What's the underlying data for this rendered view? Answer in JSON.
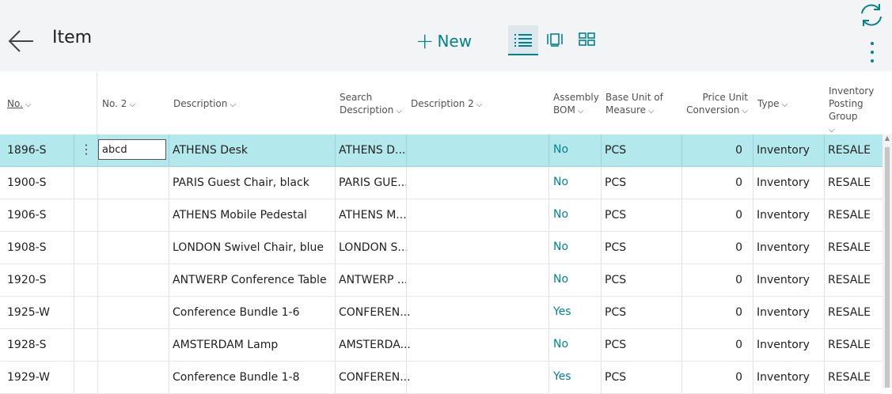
{
  "page": {
    "title": "Item",
    "new_label": "New"
  },
  "icons": {
    "back": "back-arrow-icon",
    "new": "plus-icon",
    "list_view": "list-view-icon",
    "tall_view": "tall-tiles-view-icon",
    "tile_view": "tile-view-icon",
    "refresh": "refresh-icon",
    "more": "more-options-icon"
  },
  "colors": {
    "accent": "#00838f",
    "selected_row": "#b3e8ec",
    "topbar": "#f3f4f6"
  },
  "columns": [
    {
      "key": "no",
      "label": "No.",
      "sorted": true
    },
    {
      "key": "no2",
      "label": "No. 2"
    },
    {
      "key": "description",
      "label": "Description"
    },
    {
      "key": "search_description",
      "line1": "Search",
      "line2": "Description"
    },
    {
      "key": "description2",
      "label": "Description 2"
    },
    {
      "key": "assembly_bom",
      "line1": "Assembly",
      "line2": "BOM"
    },
    {
      "key": "base_uom",
      "line1": "Base Unit of",
      "line2": "Measure"
    },
    {
      "key": "price_unit_conversion",
      "line1": "Price Unit",
      "line2": "Conversion"
    },
    {
      "key": "type",
      "label": "Type"
    },
    {
      "key": "inventory_posting_group",
      "line1": "Inventory",
      "line2": "Posting Group"
    }
  ],
  "rows": [
    {
      "no": "1896-S",
      "no2": "abcd",
      "description": "ATHENS Desk",
      "search_description": "ATHENS D...",
      "description2": "",
      "assembly_bom": "No",
      "base_uom": "PCS",
      "price_unit_conversion": "0",
      "type": "Inventory",
      "inventory_posting_group": "RESALE"
    },
    {
      "no": "1900-S",
      "no2": "",
      "description": "PARIS Guest Chair, black",
      "search_description": "PARIS GUE...",
      "description2": "",
      "assembly_bom": "No",
      "base_uom": "PCS",
      "price_unit_conversion": "0",
      "type": "Inventory",
      "inventory_posting_group": "RESALE"
    },
    {
      "no": "1906-S",
      "no2": "",
      "description": "ATHENS Mobile Pedestal",
      "search_description": "ATHENS M...",
      "description2": "",
      "assembly_bom": "No",
      "base_uom": "PCS",
      "price_unit_conversion": "0",
      "type": "Inventory",
      "inventory_posting_group": "RESALE"
    },
    {
      "no": "1908-S",
      "no2": "",
      "description": "LONDON Swivel Chair, blue",
      "search_description": "LONDON S...",
      "description2": "",
      "assembly_bom": "No",
      "base_uom": "PCS",
      "price_unit_conversion": "0",
      "type": "Inventory",
      "inventory_posting_group": "RESALE"
    },
    {
      "no": "1920-S",
      "no2": "",
      "description": "ANTWERP Conference Table",
      "search_description": "ANTWERP ...",
      "description2": "",
      "assembly_bom": "No",
      "base_uom": "PCS",
      "price_unit_conversion": "0",
      "type": "Inventory",
      "inventory_posting_group": "RESALE"
    },
    {
      "no": "1925-W",
      "no2": "",
      "description": "Conference Bundle 1-6",
      "search_description": "CONFEREN...",
      "description2": "",
      "assembly_bom": "Yes",
      "base_uom": "PCS",
      "price_unit_conversion": "0",
      "type": "Inventory",
      "inventory_posting_group": "RESALE"
    },
    {
      "no": "1928-S",
      "no2": "",
      "description": "AMSTERDAM Lamp",
      "search_description": "AMSTERDA...",
      "description2": "",
      "assembly_bom": "No",
      "base_uom": "PCS",
      "price_unit_conversion": "0",
      "type": "Inventory",
      "inventory_posting_group": "RESALE"
    },
    {
      "no": "1929-W",
      "no2": "",
      "description": "Conference Bundle 1-8",
      "search_description": "CONFEREN...",
      "description2": "",
      "assembly_bom": "Yes",
      "base_uom": "PCS",
      "price_unit_conversion": "0",
      "type": "Inventory",
      "inventory_posting_group": "RESALE"
    }
  ]
}
